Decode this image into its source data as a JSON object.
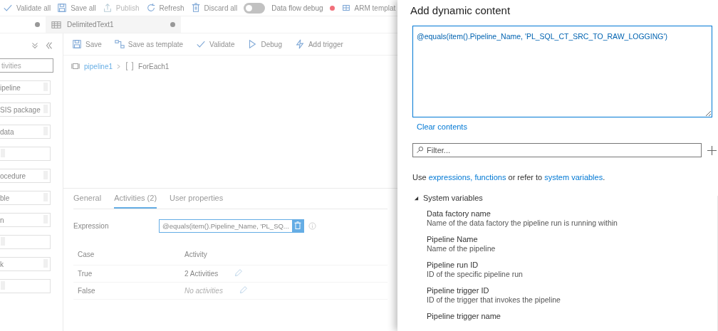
{
  "toolbar": [
    {
      "label": "Validate all",
      "kind": "check",
      "disabled": false
    },
    {
      "label": "Save all",
      "kind": "save",
      "disabled": false
    },
    {
      "label": "Publish",
      "kind": "publish",
      "disabled": true
    },
    {
      "label": "Refresh",
      "kind": "refresh",
      "disabled": false
    },
    {
      "label": "Discard all",
      "kind": "discard",
      "disabled": false
    }
  ],
  "data_flow_debug": {
    "label": "Data flow debug",
    "on": false
  },
  "arm": {
    "label": "ARM templat"
  },
  "tabs": [
    {
      "modified": true
    },
    {
      "label": "DelimitedText1",
      "modified": true
    }
  ],
  "sidebar": {
    "search": {
      "placeholder": "tivities"
    },
    "items": [
      {
        "kind": "activity",
        "label": "ipeline"
      },
      {
        "kind": "activity",
        "label": "SIS package"
      },
      {
        "kind": "activity",
        "label": "data"
      },
      {
        "kind": "activity"
      },
      {
        "kind": "activity",
        "label": "ocedure"
      },
      {
        "kind": "activity",
        "label": "ble"
      },
      {
        "kind": "activity",
        "label": "n"
      },
      {
        "kind": "activity"
      },
      {
        "kind": "activity",
        "label": "k"
      },
      {
        "kind": "activity"
      }
    ]
  },
  "pipeline_toolbar": [
    {
      "label": "Save",
      "kind": "save"
    },
    {
      "label": "Save as template",
      "kind": "template"
    },
    {
      "label": "Validate",
      "kind": "check"
    },
    {
      "label": "Debug",
      "kind": "play"
    },
    {
      "label": "Add trigger",
      "kind": "bolt"
    }
  ],
  "breadcrumb": [
    "pipeline1",
    "ForEach1"
  ],
  "properties": {
    "tabs": [
      {
        "label": "General",
        "selected": false
      },
      {
        "label": "Activities (2)",
        "selected": true
      },
      {
        "label": "User properties",
        "selected": false
      }
    ],
    "expression": {
      "label": "Expression",
      "value": "@equals(item().Pipeline_Name, 'PL_SQ..."
    },
    "columns": [
      "Case",
      "Activity"
    ],
    "rows": [
      {
        "case": "True",
        "activity": "2 Activities",
        "empty": false
      },
      {
        "case": "False",
        "activity": "No activities",
        "empty": true
      }
    ]
  },
  "panel": {
    "title": "Add dynamic content",
    "expression": "@equals(item().Pipeline_Name, 'PL_SQL_CT_SRC_TO_RAW_LOGGING')",
    "clear": "Clear contents",
    "filter": {
      "placeholder": "Filter..."
    },
    "help": {
      "before": "Use ",
      "link_1": "expressions, functions",
      "middle": " or refer to ",
      "link_2": "system variables",
      "after": "."
    },
    "tree": [
      {
        "label": "System variables",
        "expanded": true,
        "children": [
          {
            "name": "Data factory name",
            "description": "Name of the data factory the pipeline run is running within"
          },
          {
            "name": "Pipeline Name",
            "description": "Name of the pipeline"
          },
          {
            "name": "Pipeline run ID",
            "description": "ID of the specific pipeline run"
          },
          {
            "name": "Pipeline trigger ID",
            "description": "ID of the trigger that invokes the pipeline"
          },
          {
            "name": "Pipeline trigger name"
          }
        ]
      }
    ]
  }
}
